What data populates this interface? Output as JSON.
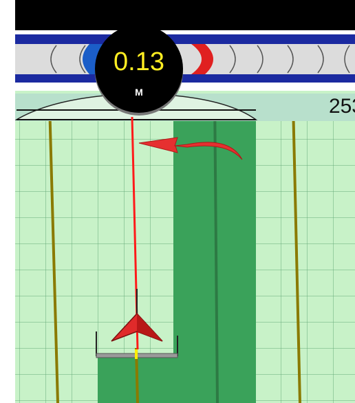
{
  "guidance": {
    "cross_track_error": "0.13",
    "unit": "M",
    "distance_readout": "253"
  },
  "colors": {
    "coverage": "#3aa25a",
    "guide_line": "#ff1a1a",
    "track_line": "#8a7a00",
    "grid": "#3b8a55",
    "lightbar_active": "#e02020",
    "lightbar_frame": "#1b2aa0"
  },
  "icons": [
    "turn-arrow-icon",
    "vehicle-arrow-icon"
  ]
}
